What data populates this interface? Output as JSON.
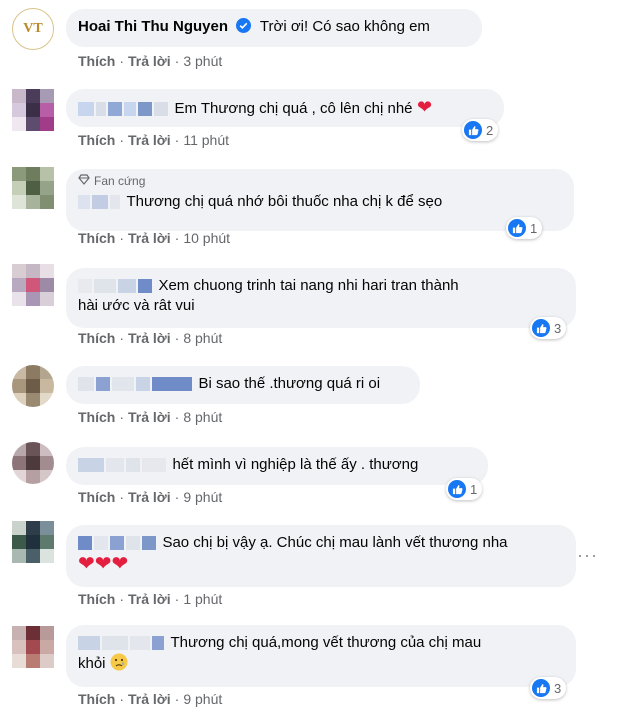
{
  "actions": {
    "like": "Thích",
    "sep": "·",
    "reply": "Trả lời"
  },
  "comments": [
    {
      "author": "Hoai Thi Thu Nguyen",
      "text": "Trời ơi! Có sao không em",
      "time": "3 phút",
      "verified": true,
      "logo_text": "VT"
    },
    {
      "text": "Em Thương chị quá , cô lên chị nhé",
      "time": "11 phút",
      "likes": "2"
    },
    {
      "badge": "Fan cứng",
      "text": "Thương chị quá nhớ bôi thuốc nha chị k để sẹo",
      "time": "10 phút",
      "likes": "1"
    },
    {
      "text_line1": "Xem chuong trinh tai nang nhi hari tran thành",
      "text_line2": "hài ước và rât vui",
      "time": "8 phút",
      "likes": "3"
    },
    {
      "text": "Bi sao thế .thương quá ri oi",
      "time": "8 phút"
    },
    {
      "text": "hết mình vì nghiệp là thế ấy . thương",
      "time": "9 phút",
      "likes": "1"
    },
    {
      "text": "Sao chị bị vậy ạ. Chúc chị mau lành vết thương nha",
      "time": "1 phút"
    },
    {
      "text_line1": "Thương chị quá,mong vết thương của chị mau",
      "text_line2": "khỏi",
      "time": "9 phút",
      "likes": "3"
    }
  ],
  "colors": {
    "like_blue": "#1877f2",
    "bubble": "#f0f2f5",
    "meta": "#65676b"
  }
}
